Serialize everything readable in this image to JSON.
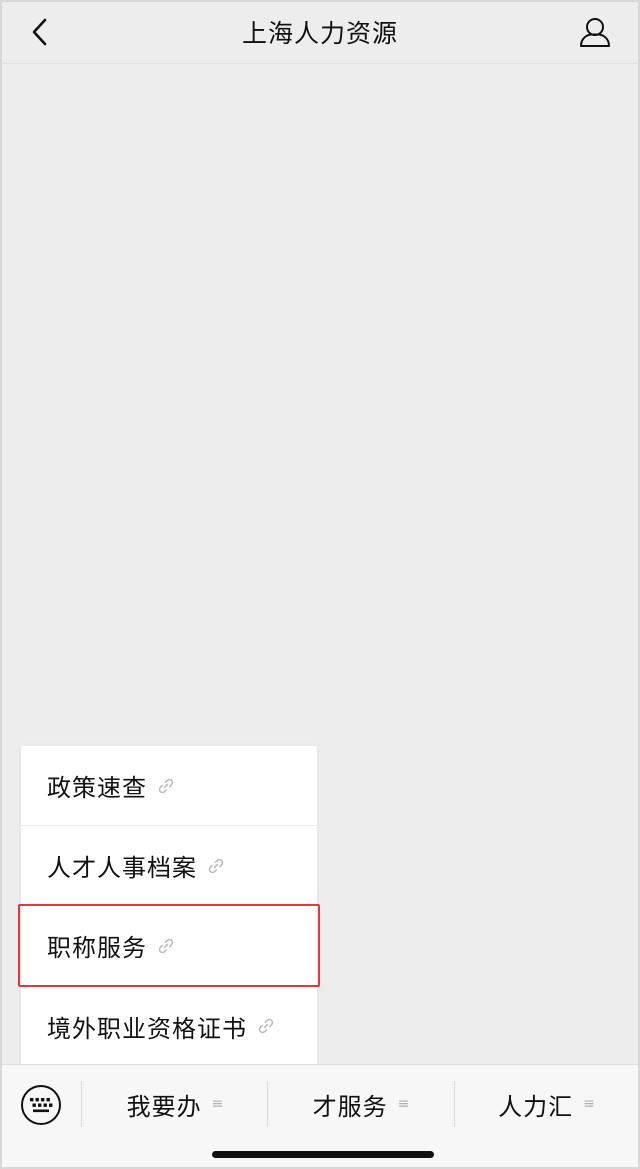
{
  "header": {
    "title": "上海人力资源",
    "back_icon": "chevron-left-icon",
    "profile_icon": "user-icon"
  },
  "popup_menu": {
    "items": [
      {
        "label": "政策速查",
        "icon": "link-icon",
        "highlighted": false
      },
      {
        "label": "人才人事档案",
        "icon": "link-icon",
        "highlighted": false
      },
      {
        "label": "职称服务",
        "icon": "link-icon",
        "highlighted": true
      },
      {
        "label": "境外职业资格证书",
        "icon": "link-icon",
        "highlighted": false
      }
    ],
    "highlight_color": "#e03a3a"
  },
  "bottom_bar": {
    "keyboard_icon": "keyboard-icon",
    "tabs": [
      {
        "label": "我要办",
        "menu_icon": "≡"
      },
      {
        "label": "才服务",
        "menu_icon": "≡"
      },
      {
        "label": "人力汇",
        "menu_icon": "≡"
      }
    ]
  },
  "colors": {
    "background": "#ededed",
    "bar_background": "#f7f7f7",
    "text": "#111111"
  }
}
